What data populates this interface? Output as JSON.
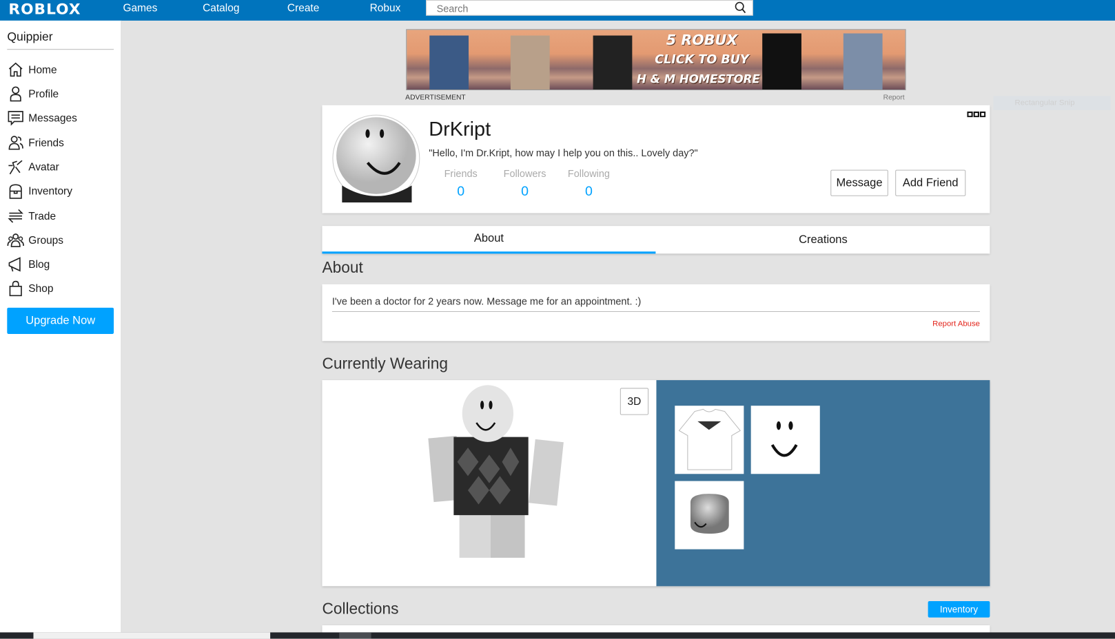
{
  "topbar": {
    "logo": "ROBLOX",
    "nav": [
      "Games",
      "Catalog",
      "Create",
      "Robux"
    ],
    "search_placeholder": "Search",
    "color": "#0074bd"
  },
  "sidebar": {
    "username": "Quippier",
    "items": [
      {
        "label": "Home",
        "icon": "home-icon"
      },
      {
        "label": "Profile",
        "icon": "profile-icon"
      },
      {
        "label": "Messages",
        "icon": "messages-icon"
      },
      {
        "label": "Friends",
        "icon": "friends-icon"
      },
      {
        "label": "Avatar",
        "icon": "avatar-icon"
      },
      {
        "label": "Inventory",
        "icon": "inventory-icon"
      },
      {
        "label": "Trade",
        "icon": "trade-icon"
      },
      {
        "label": "Groups",
        "icon": "groups-icon"
      },
      {
        "label": "Blog",
        "icon": "blog-icon"
      },
      {
        "label": "Shop",
        "icon": "shop-icon"
      }
    ],
    "upgrade": "Upgrade Now"
  },
  "ad": {
    "line1": "5 ROBUX",
    "line2": "CLICK TO BUY",
    "line3": "H & M HOMESTORE",
    "label": "ADVERTISEMENT",
    "report": "Report"
  },
  "snip": "Rectangular Snip",
  "profile": {
    "name": "DrKript",
    "status": "\"Hello, I'm Dr.Kript, how may I help you on this.. Lovely day?\"",
    "stats": [
      {
        "label": "Friends",
        "value": "0"
      },
      {
        "label": "Followers",
        "value": "0"
      },
      {
        "label": "Following",
        "value": "0"
      }
    ],
    "message": "Message",
    "add_friend": "Add Friend"
  },
  "tabs": [
    {
      "label": "About",
      "active": true
    },
    {
      "label": "Creations",
      "active": false
    }
  ],
  "about": {
    "title": "About",
    "text": "I've been a doctor for 2 years now. Message me for an appointment. :)",
    "report": "Report Abuse"
  },
  "wearing": {
    "title": "Currently Wearing",
    "toggle": "3D",
    "panel_color": "#3d7399"
  },
  "collections": {
    "title": "Collections",
    "inventory": "Inventory"
  }
}
